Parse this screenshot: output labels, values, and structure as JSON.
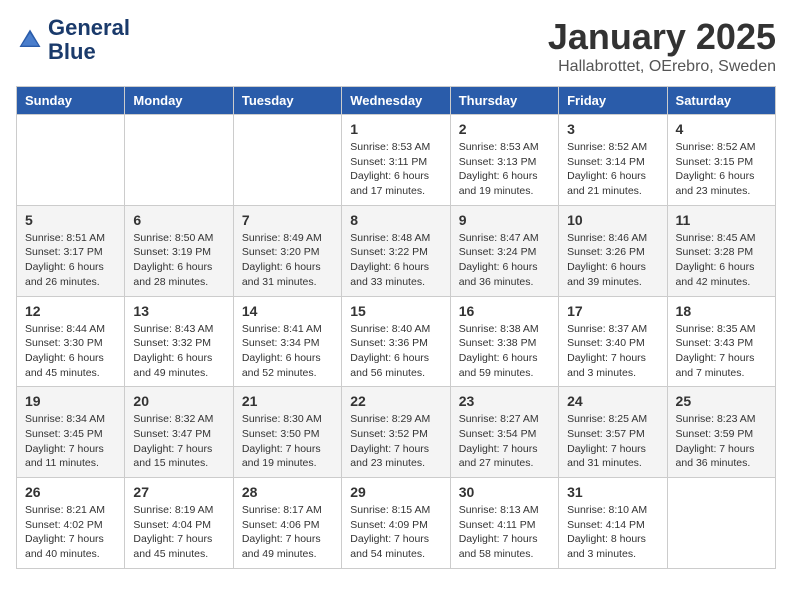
{
  "header": {
    "logo_line1": "General",
    "logo_line2": "Blue",
    "month_title": "January 2025",
    "location": "Hallabrottet, OErebro, Sweden"
  },
  "days_of_week": [
    "Sunday",
    "Monday",
    "Tuesday",
    "Wednesday",
    "Thursday",
    "Friday",
    "Saturday"
  ],
  "weeks": [
    [
      {
        "day": "",
        "info": ""
      },
      {
        "day": "",
        "info": ""
      },
      {
        "day": "",
        "info": ""
      },
      {
        "day": "1",
        "info": "Sunrise: 8:53 AM\nSunset: 3:11 PM\nDaylight: 6 hours\nand 17 minutes."
      },
      {
        "day": "2",
        "info": "Sunrise: 8:53 AM\nSunset: 3:13 PM\nDaylight: 6 hours\nand 19 minutes."
      },
      {
        "day": "3",
        "info": "Sunrise: 8:52 AM\nSunset: 3:14 PM\nDaylight: 6 hours\nand 21 minutes."
      },
      {
        "day": "4",
        "info": "Sunrise: 8:52 AM\nSunset: 3:15 PM\nDaylight: 6 hours\nand 23 minutes."
      }
    ],
    [
      {
        "day": "5",
        "info": "Sunrise: 8:51 AM\nSunset: 3:17 PM\nDaylight: 6 hours\nand 26 minutes."
      },
      {
        "day": "6",
        "info": "Sunrise: 8:50 AM\nSunset: 3:19 PM\nDaylight: 6 hours\nand 28 minutes."
      },
      {
        "day": "7",
        "info": "Sunrise: 8:49 AM\nSunset: 3:20 PM\nDaylight: 6 hours\nand 31 minutes."
      },
      {
        "day": "8",
        "info": "Sunrise: 8:48 AM\nSunset: 3:22 PM\nDaylight: 6 hours\nand 33 minutes."
      },
      {
        "day": "9",
        "info": "Sunrise: 8:47 AM\nSunset: 3:24 PM\nDaylight: 6 hours\nand 36 minutes."
      },
      {
        "day": "10",
        "info": "Sunrise: 8:46 AM\nSunset: 3:26 PM\nDaylight: 6 hours\nand 39 minutes."
      },
      {
        "day": "11",
        "info": "Sunrise: 8:45 AM\nSunset: 3:28 PM\nDaylight: 6 hours\nand 42 minutes."
      }
    ],
    [
      {
        "day": "12",
        "info": "Sunrise: 8:44 AM\nSunset: 3:30 PM\nDaylight: 6 hours\nand 45 minutes."
      },
      {
        "day": "13",
        "info": "Sunrise: 8:43 AM\nSunset: 3:32 PM\nDaylight: 6 hours\nand 49 minutes."
      },
      {
        "day": "14",
        "info": "Sunrise: 8:41 AM\nSunset: 3:34 PM\nDaylight: 6 hours\nand 52 minutes."
      },
      {
        "day": "15",
        "info": "Sunrise: 8:40 AM\nSunset: 3:36 PM\nDaylight: 6 hours\nand 56 minutes."
      },
      {
        "day": "16",
        "info": "Sunrise: 8:38 AM\nSunset: 3:38 PM\nDaylight: 6 hours\nand 59 minutes."
      },
      {
        "day": "17",
        "info": "Sunrise: 8:37 AM\nSunset: 3:40 PM\nDaylight: 7 hours\nand 3 minutes."
      },
      {
        "day": "18",
        "info": "Sunrise: 8:35 AM\nSunset: 3:43 PM\nDaylight: 7 hours\nand 7 minutes."
      }
    ],
    [
      {
        "day": "19",
        "info": "Sunrise: 8:34 AM\nSunset: 3:45 PM\nDaylight: 7 hours\nand 11 minutes."
      },
      {
        "day": "20",
        "info": "Sunrise: 8:32 AM\nSunset: 3:47 PM\nDaylight: 7 hours\nand 15 minutes."
      },
      {
        "day": "21",
        "info": "Sunrise: 8:30 AM\nSunset: 3:50 PM\nDaylight: 7 hours\nand 19 minutes."
      },
      {
        "day": "22",
        "info": "Sunrise: 8:29 AM\nSunset: 3:52 PM\nDaylight: 7 hours\nand 23 minutes."
      },
      {
        "day": "23",
        "info": "Sunrise: 8:27 AM\nSunset: 3:54 PM\nDaylight: 7 hours\nand 27 minutes."
      },
      {
        "day": "24",
        "info": "Sunrise: 8:25 AM\nSunset: 3:57 PM\nDaylight: 7 hours\nand 31 minutes."
      },
      {
        "day": "25",
        "info": "Sunrise: 8:23 AM\nSunset: 3:59 PM\nDaylight: 7 hours\nand 36 minutes."
      }
    ],
    [
      {
        "day": "26",
        "info": "Sunrise: 8:21 AM\nSunset: 4:02 PM\nDaylight: 7 hours\nand 40 minutes."
      },
      {
        "day": "27",
        "info": "Sunrise: 8:19 AM\nSunset: 4:04 PM\nDaylight: 7 hours\nand 45 minutes."
      },
      {
        "day": "28",
        "info": "Sunrise: 8:17 AM\nSunset: 4:06 PM\nDaylight: 7 hours\nand 49 minutes."
      },
      {
        "day": "29",
        "info": "Sunrise: 8:15 AM\nSunset: 4:09 PM\nDaylight: 7 hours\nand 54 minutes."
      },
      {
        "day": "30",
        "info": "Sunrise: 8:13 AM\nSunset: 4:11 PM\nDaylight: 7 hours\nand 58 minutes."
      },
      {
        "day": "31",
        "info": "Sunrise: 8:10 AM\nSunset: 4:14 PM\nDaylight: 8 hours\nand 3 minutes."
      },
      {
        "day": "",
        "info": ""
      }
    ]
  ]
}
